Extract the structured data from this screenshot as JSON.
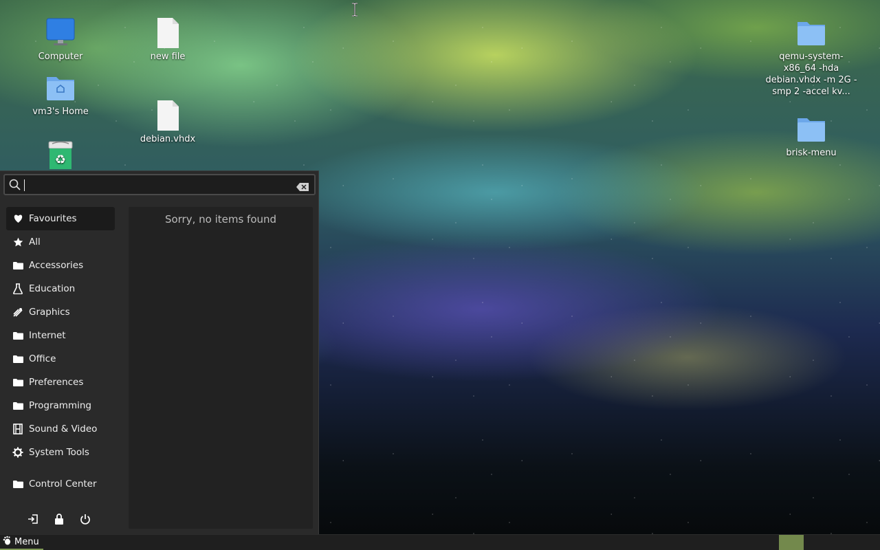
{
  "desktop": {
    "icons": [
      {
        "label": "Computer",
        "icon": "monitor-icon"
      },
      {
        "label": "vm3's Home",
        "icon": "home-folder-icon"
      },
      {
        "label": "Trash",
        "icon": "trash-icon"
      },
      {
        "label": "new file",
        "icon": "file-icon"
      },
      {
        "label": "debian.vhdx",
        "icon": "file-icon"
      },
      {
        "label": "qemu-system-x86_64 -hda debian.vhdx -m 2G -smp 2 -accel kv...",
        "icon": "folder-icon"
      },
      {
        "label": "brisk-menu",
        "icon": "folder-icon"
      }
    ]
  },
  "menu": {
    "search": {
      "value": "",
      "placeholder": ""
    },
    "categories": [
      {
        "label": "Favourites",
        "icon": "heart-icon",
        "active": true
      },
      {
        "label": "All",
        "icon": "star-icon"
      },
      {
        "label": "Accessories",
        "icon": "folder-icon"
      },
      {
        "label": "Education",
        "icon": "flask-icon"
      },
      {
        "label": "Graphics",
        "icon": "palette-icon"
      },
      {
        "label": "Internet",
        "icon": "folder-icon"
      },
      {
        "label": "Office",
        "icon": "folder-icon"
      },
      {
        "label": "Preferences",
        "icon": "folder-icon"
      },
      {
        "label": "Programming",
        "icon": "folder-icon"
      },
      {
        "label": "Sound & Video",
        "icon": "film-icon"
      },
      {
        "label": "System Tools",
        "icon": "gear-icon"
      },
      {
        "label": "Control Center",
        "icon": "folder-icon"
      }
    ],
    "empty_message": "Sorry, no items found",
    "session_buttons": [
      "logout-icon",
      "lock-icon",
      "power-icon"
    ]
  },
  "panel": {
    "menu_label": "Menu",
    "accent": "#73894c"
  }
}
